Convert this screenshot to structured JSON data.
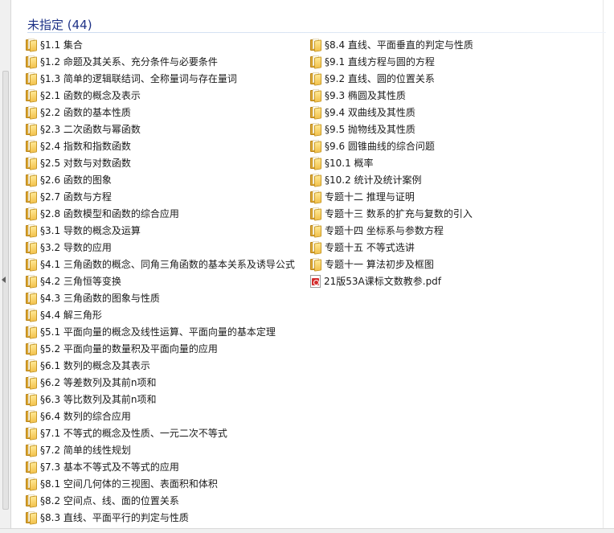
{
  "group": {
    "title": "未指定 (44)"
  },
  "left_items": [
    {
      "label": "§1.1 集合",
      "icon": "folder-icon"
    },
    {
      "label": "§1.2 命题及其关系、充分条件与必要条件",
      "icon": "folder-icon"
    },
    {
      "label": "§1.3 简单的逻辑联结词、全称量词与存在量词",
      "icon": "folder-icon"
    },
    {
      "label": "§2.1 函数的概念及表示",
      "icon": "folder-icon"
    },
    {
      "label": "§2.2 函数的基本性质",
      "icon": "folder-icon"
    },
    {
      "label": "§2.3 二次函数与幂函数",
      "icon": "folder-icon"
    },
    {
      "label": "§2.4 指数和指数函数",
      "icon": "folder-icon"
    },
    {
      "label": "§2.5 对数与对数函数",
      "icon": "folder-icon"
    },
    {
      "label": "§2.6 函数的图象",
      "icon": "folder-icon"
    },
    {
      "label": "§2.7 函数与方程",
      "icon": "folder-icon"
    },
    {
      "label": "§2.8 函数模型和函数的综合应用",
      "icon": "folder-icon"
    },
    {
      "label": "§3.1 导数的概念及运算",
      "icon": "folder-icon"
    },
    {
      "label": "§3.2 导数的应用",
      "icon": "folder-icon"
    },
    {
      "label": "§4.1 三角函数的概念、同角三角函数的基本关系及诱导公式",
      "icon": "folder-icon"
    },
    {
      "label": "§4.2 三角恒等变换",
      "icon": "folder-icon"
    },
    {
      "label": "§4.3 三角函数的图象与性质",
      "icon": "folder-icon"
    },
    {
      "label": "§4.4 解三角形",
      "icon": "folder-icon"
    },
    {
      "label": "§5.1 平面向量的概念及线性运算、平面向量的基本定理",
      "icon": "folder-icon"
    },
    {
      "label": "§5.2 平面向量的数量积及平面向量的应用",
      "icon": "folder-icon"
    },
    {
      "label": "§6.1 数列的概念及其表示",
      "icon": "folder-icon"
    },
    {
      "label": "§6.2 等差数列及其前n项和",
      "icon": "folder-icon"
    },
    {
      "label": "§6.3 等比数列及其前n项和",
      "icon": "folder-icon"
    },
    {
      "label": "§6.4 数列的综合应用",
      "icon": "folder-icon"
    },
    {
      "label": "§7.1 不等式的概念及性质、一元二次不等式",
      "icon": "folder-icon"
    },
    {
      "label": "§7.2 简单的线性规划",
      "icon": "folder-icon"
    },
    {
      "label": "§7.3 基本不等式及不等式的应用",
      "icon": "folder-icon"
    },
    {
      "label": "§8.1 空间几何体的三视图、表面积和体积",
      "icon": "folder-icon"
    },
    {
      "label": "§8.2 空间点、线、面的位置关系",
      "icon": "folder-icon"
    },
    {
      "label": "§8.3 直线、平面平行的判定与性质",
      "icon": "folder-icon"
    }
  ],
  "right_items": [
    {
      "label": "§8.4 直线、平面垂直的判定与性质",
      "icon": "folder-icon"
    },
    {
      "label": "§9.1 直线方程与圆的方程",
      "icon": "folder-icon"
    },
    {
      "label": "§9.2 直线、圆的位置关系",
      "icon": "folder-icon"
    },
    {
      "label": "§9.3 椭圆及其性质",
      "icon": "folder-icon"
    },
    {
      "label": "§9.4 双曲线及其性质",
      "icon": "folder-icon"
    },
    {
      "label": "§9.5 抛物线及其性质",
      "icon": "folder-icon"
    },
    {
      "label": "§9.6 圆锥曲线的综合问题",
      "icon": "folder-icon"
    },
    {
      "label": "§10.1 概率",
      "icon": "folder-icon"
    },
    {
      "label": "§10.2 统计及统计案例",
      "icon": "folder-icon"
    },
    {
      "label": "专题十二 推理与证明",
      "icon": "folder-icon"
    },
    {
      "label": "专题十三 数系的扩充与复数的引入",
      "icon": "folder-icon"
    },
    {
      "label": "专题十四 坐标系与参数方程",
      "icon": "folder-icon"
    },
    {
      "label": "专题十五 不等式选讲",
      "icon": "folder-icon"
    },
    {
      "label": "专题十一 算法初步及框图",
      "icon": "folder-icon"
    },
    {
      "label": "21版53A课标文数教参.pdf",
      "icon": "pdf-icon"
    }
  ]
}
